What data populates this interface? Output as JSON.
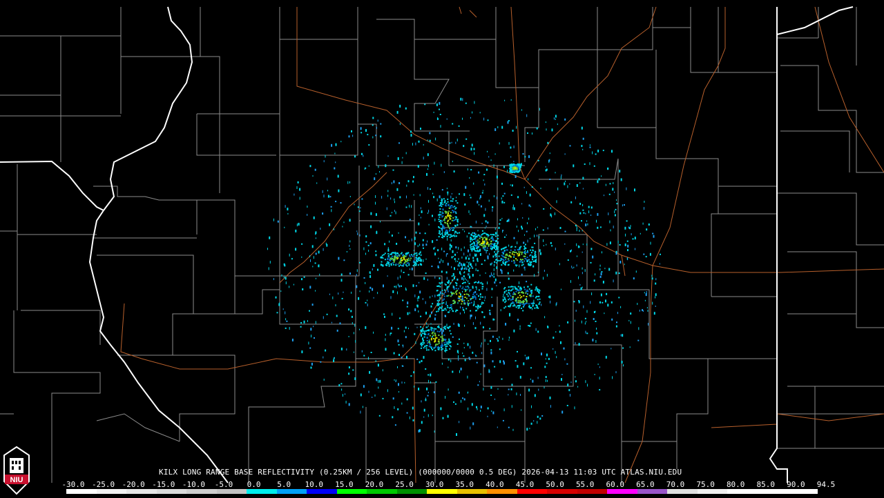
{
  "caption": "KILX LONG RANGE BASE REFLECTIVITY (0.25KM / 256 LEVEL) (000000/0000 0.5 DEG) 2026-04-13 11:03 UTC  ATLAS.NIU.EDU",
  "logo_text": "NIU",
  "legend": {
    "ticks": [
      "-30.0",
      "-25.0",
      "-20.0",
      "-15.0",
      "-10.0",
      "-5.0",
      "0.0",
      "5.0",
      "10.0",
      "15.0",
      "20.0",
      "25.0",
      "30.0",
      "35.0",
      "40.0",
      "45.0",
      "50.0",
      "55.0",
      "60.0",
      "65.0",
      "70.0",
      "75.0",
      "80.0",
      "85.0",
      "90.0",
      "94.5"
    ],
    "colors": [
      "#ffffff",
      "#f2f2f2",
      "#e6e6e6",
      "#dadada",
      "#cecece",
      "#c2c2c2",
      "#00ecec",
      "#01a0f6",
      "#0000f6",
      "#00ff00",
      "#00c800",
      "#009000",
      "#ffff00",
      "#e7c000",
      "#ff9000",
      "#ff0000",
      "#d60000",
      "#c00000",
      "#ff00ff",
      "#9955c9",
      "#e0e0e0",
      "#f0f0f0",
      "#ffffff",
      "#ffffff",
      "#ffffff"
    ]
  },
  "map": {
    "state_border_color": "#ffffff",
    "county_line_color": "#9a9a9a",
    "highway_color": "#b8602c",
    "echo_colors": [
      "#00d8e8",
      "#1ea0f0",
      "#0070c8",
      "#20c060",
      "#60d040",
      "#d0e000"
    ]
  }
}
